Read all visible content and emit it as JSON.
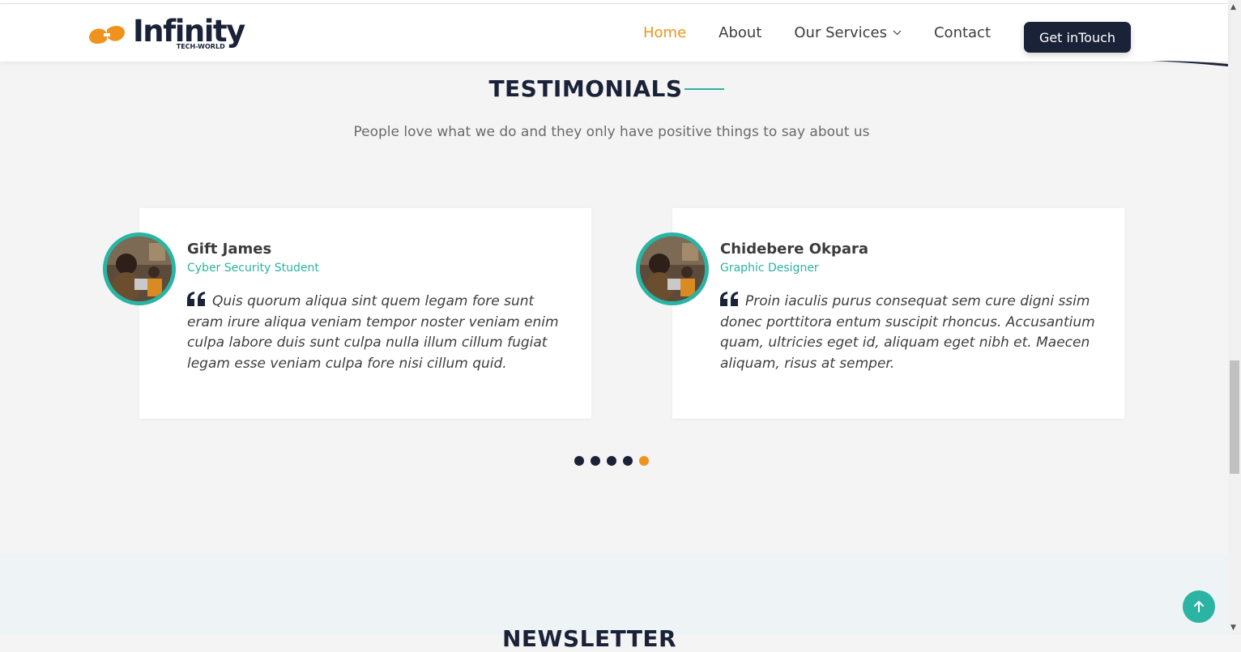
{
  "brand": {
    "name": "Infinity",
    "tagline": "TECH-WORLD",
    "colors": {
      "orange": "#f0921e",
      "navy": "#1a2238",
      "teal": "#2bb3a3"
    }
  },
  "nav": {
    "items": [
      {
        "label": "Home",
        "active": true
      },
      {
        "label": "About",
        "active": false
      },
      {
        "label": "Our Services",
        "active": false,
        "has_dropdown": true
      },
      {
        "label": "Contact",
        "active": false
      }
    ],
    "cta_label": "Get inTouch"
  },
  "testimonials": {
    "title": "TESTIMONIALS",
    "subtitle": "People love what we do and they only have positive things to say about us",
    "cards": [
      {
        "name": "Gift James",
        "role": "Cyber Security Student",
        "quote": "Quis quorum aliqua sint quem legam fore sunt eram irure aliqua veniam tempor noster veniam enim culpa labore duis sunt culpa nulla illum cillum fugiat legam esse veniam culpa fore nisi cillum quid."
      },
      {
        "name": "Chidebere Okpara",
        "role": "Graphic Designer",
        "quote": "Proin iaculis purus consequat sem cure digni ssim donec porttitora entum suscipit rhoncus. Accusantium quam, ultricies eget id, aliquam eget nibh et. Maecen aliquam, risus at semper."
      }
    ],
    "carousel": {
      "total": 5,
      "active_index": 4
    }
  },
  "newsletter": {
    "title": "NEWSLETTER"
  },
  "icons": {
    "quote": "quote-icon",
    "back_to_top": "arrow-up-icon",
    "dropdown": "chevron-down-icon"
  }
}
